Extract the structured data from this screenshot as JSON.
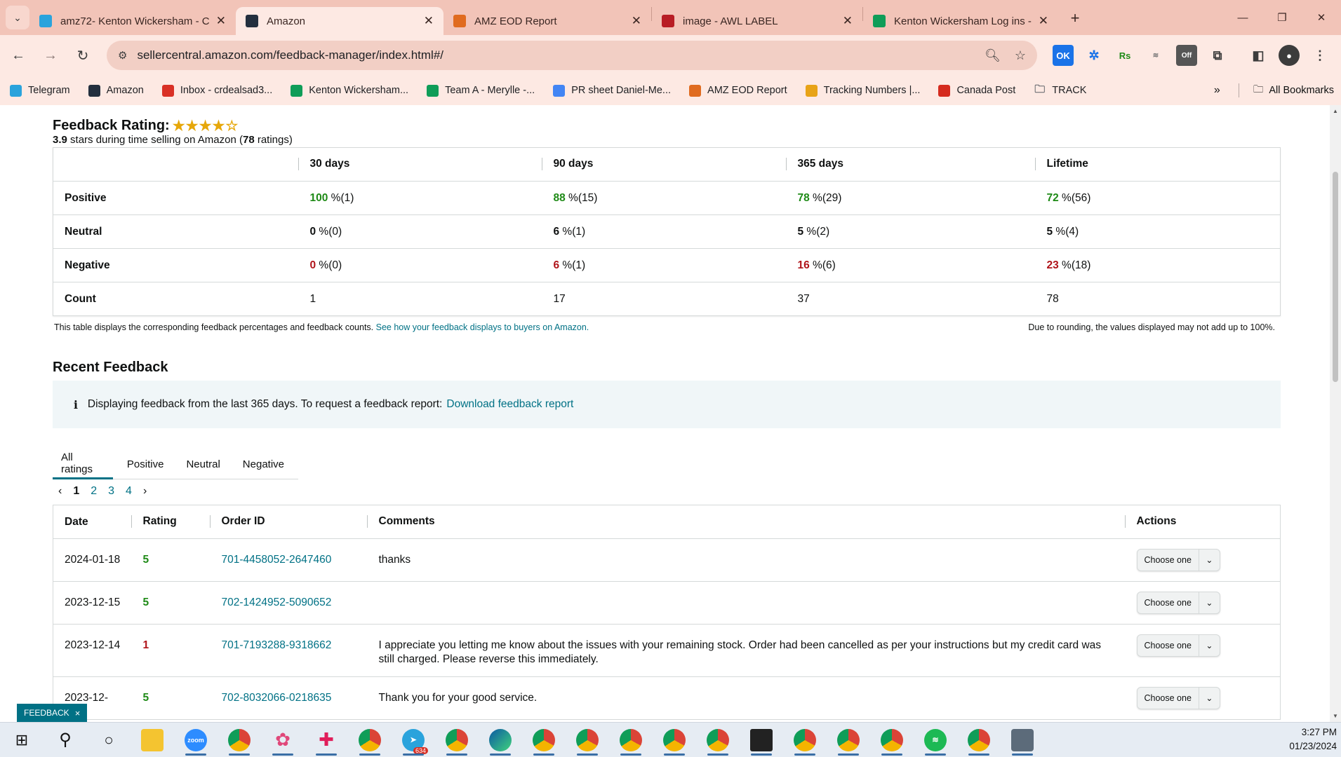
{
  "browser": {
    "tabs": [
      {
        "title": "amz72- Kenton Wickersham - C",
        "icon": "telegram-icon",
        "icon_color": "#2aa3dc",
        "active": false
      },
      {
        "title": "Amazon",
        "icon": "amazon-icon",
        "icon_color": "#232f3e",
        "active": true
      },
      {
        "title": "AMZ EOD Report",
        "icon": "eod-report-icon",
        "icon_color": "#e06b1f",
        "active": false
      },
      {
        "title": "image - AWL LABEL",
        "icon": "awl-icon",
        "icon_color": "#b81d24",
        "active": false
      },
      {
        "title": "Kenton Wickersham Log ins - G",
        "icon": "sheets-icon",
        "icon_color": "#0f9d58",
        "active": false
      }
    ],
    "url": "sellercentral.amazon.com/feedback-manager/index.html#/",
    "bookmarks": [
      {
        "label": "Telegram",
        "icon": "telegram-icon",
        "color": "#2aa3dc"
      },
      {
        "label": "Amazon",
        "icon": "amazon-icon",
        "color": "#232f3e"
      },
      {
        "label": "Inbox - crdealsad3...",
        "icon": "gmail-icon",
        "color": "#d93025"
      },
      {
        "label": "Kenton Wickersham...",
        "icon": "sheets-icon",
        "color": "#0f9d58"
      },
      {
        "label": "Team A - Merylle -...",
        "icon": "sheets-icon",
        "color": "#0f9d58"
      },
      {
        "label": "PR sheet Daniel-Me...",
        "icon": "google-icon",
        "color": "#4285f4"
      },
      {
        "label": "AMZ EOD Report",
        "icon": "eod-report-icon",
        "color": "#e06b1f"
      },
      {
        "label": "Tracking Numbers |...",
        "icon": "taco-icon",
        "color": "#e8a317"
      },
      {
        "label": "Canada Post",
        "icon": "canada-post-icon",
        "color": "#d52b1e"
      },
      {
        "label": "TRACK",
        "icon": "folder-icon",
        "color": "#5f6368"
      }
    ],
    "all_bookmarks_label": "All Bookmarks"
  },
  "feedback": {
    "title": "Feedback Rating:",
    "stars_filled": 4,
    "stars_total": 5,
    "score": "3.9",
    "summary_mid": " stars during time selling on Amazon (",
    "ratings_count": "78",
    "summary_end": " ratings)",
    "columns": [
      "30 days",
      "90 days",
      "365 days",
      "Lifetime"
    ],
    "rows": [
      {
        "label": "Positive",
        "kind": "pos",
        "cells": [
          {
            "pct": "100",
            "count": " %(1)"
          },
          {
            "pct": "88",
            "count": " %(15)"
          },
          {
            "pct": "78",
            "count": " %(29)"
          },
          {
            "pct": "72",
            "count": " %(56)"
          }
        ]
      },
      {
        "label": "Neutral",
        "kind": "neu",
        "cells": [
          {
            "pct": "0",
            "count": " %(0)"
          },
          {
            "pct": "6",
            "count": " %(1)"
          },
          {
            "pct": "5",
            "count": " %(2)"
          },
          {
            "pct": "5",
            "count": " %(4)"
          }
        ]
      },
      {
        "label": "Negative",
        "kind": "neg",
        "cells": [
          {
            "pct": "0",
            "count": " %(0)"
          },
          {
            "pct": "6",
            "count": " %(1)"
          },
          {
            "pct": "16",
            "count": " %(6)"
          },
          {
            "pct": "23",
            "count": " %(18)"
          }
        ]
      },
      {
        "label": "Count",
        "kind": "count",
        "cells": [
          {
            "pct": "",
            "count": "1"
          },
          {
            "pct": "",
            "count": "17"
          },
          {
            "pct": "",
            "count": "37"
          },
          {
            "pct": "",
            "count": "78"
          }
        ]
      }
    ],
    "note_left": "This table displays the corresponding feedback percentages and feedback counts. ",
    "note_link": "See how your feedback displays to buyers on Amazon.",
    "note_right": "Due to rounding, the values displayed may not add up to 100%."
  },
  "recent": {
    "title": "Recent Feedback",
    "info_text": "Displaying feedback from the last 365 days. To request a feedback report:",
    "info_link": "Download feedback report",
    "tabs": [
      "All ratings",
      "Positive",
      "Neutral",
      "Negative"
    ],
    "pages": [
      "1",
      "2",
      "3",
      "4"
    ],
    "columns": [
      "Date",
      "Rating",
      "Order ID",
      "Comments",
      "Actions"
    ],
    "rows": [
      {
        "date": "2024-01-18",
        "rating": "5",
        "order_id": "701-4458052-2647460",
        "comment": "thanks",
        "action": "Choose one"
      },
      {
        "date": "2023-12-15",
        "rating": "5",
        "order_id": "702-1424952-5090652",
        "comment": "",
        "action": "Choose one"
      },
      {
        "date": "2023-12-14",
        "rating": "1",
        "order_id": "701-7193288-9318662",
        "comment": "I appreciate you letting me know about the issues with your remaining stock. Order had been cancelled as per your instructions but my credit card was still charged. Please reverse this immediately.",
        "action": "Choose one"
      }
    ],
    "partial_row": {
      "date": "2023-12-",
      "rating": "5",
      "order_id": "702-8032066-0218635",
      "comment": "Thank you for your good service.",
      "action": "Choose one"
    }
  },
  "feedback_tab": {
    "label": "FEEDBACK",
    "close": "×"
  },
  "taskbar": {
    "time": "3:27 PM",
    "date": "01/23/2024",
    "badge": "634"
  }
}
